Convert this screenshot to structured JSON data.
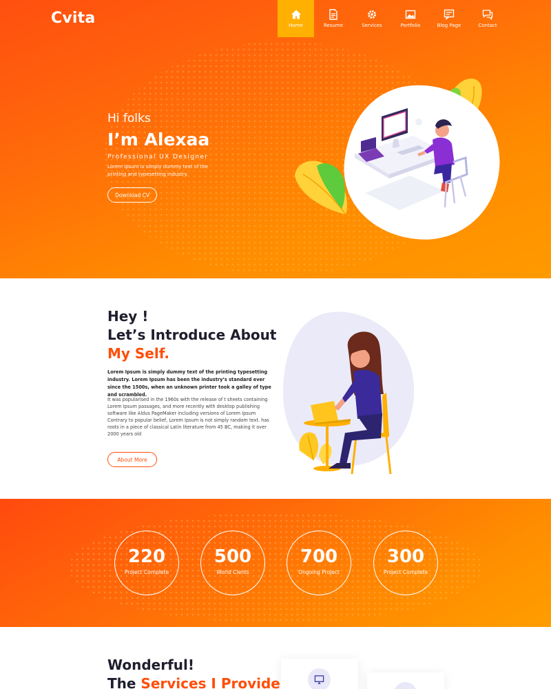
{
  "brand": {
    "logo": "Cvita",
    "accent": "#ff4e0a",
    "nav_active": "#ffb000"
  },
  "nav": [
    {
      "label": "Home",
      "icon": "home-icon",
      "active": true
    },
    {
      "label": "Resume",
      "icon": "resume-icon",
      "active": false
    },
    {
      "label": "Services",
      "icon": "gear-icon",
      "active": false
    },
    {
      "label": "Portfolio",
      "icon": "image-icon",
      "active": false
    },
    {
      "label": "Blog Page",
      "icon": "blog-icon",
      "active": false
    },
    {
      "label": "Contact",
      "icon": "chat-icon",
      "active": false
    }
  ],
  "hero": {
    "greeting": "Hi folks",
    "name": "I’m Alexaa",
    "role": "Professional UX Designer",
    "description": "Lorem Ipsum is simply dummy text of the printing and typesetting industry.",
    "cta": "Download CV"
  },
  "about": {
    "line1": "Hey !",
    "line2": "Let’s  Introduce About",
    "line3": "My Self.",
    "para1": "Lorem Ipsum is simply dummy text of the printing typesetting industry. Lorem Ipsum has been the industry’s standard ever since the 1500s, when an unknown printer took a galley of type and scrambled.",
    "para2": " It was popularised in the 1960s with the release of t sheets containing  Lorem Ipsum passages, and more recently with desktop publishing software like Aldus PageMaker including versions of Lorem Ipsum Contrary to popular belief, Lorem Ipsum is not simply random text. has roots in a piece of classical Latin literature from 45 BC, making  it over 2000 years old",
    "cta": "About More"
  },
  "stats": [
    {
      "value": "220",
      "label": "Project  Complete"
    },
    {
      "value": "500",
      "label": "World Cients"
    },
    {
      "value": "700",
      "label": "Ongoing Project"
    },
    {
      "value": "300",
      "label": "Project  Complete"
    }
  ],
  "services": {
    "line1": "Wonderful!",
    "line2_prefix": "The ",
    "line2_accent": "Services I Provide"
  }
}
